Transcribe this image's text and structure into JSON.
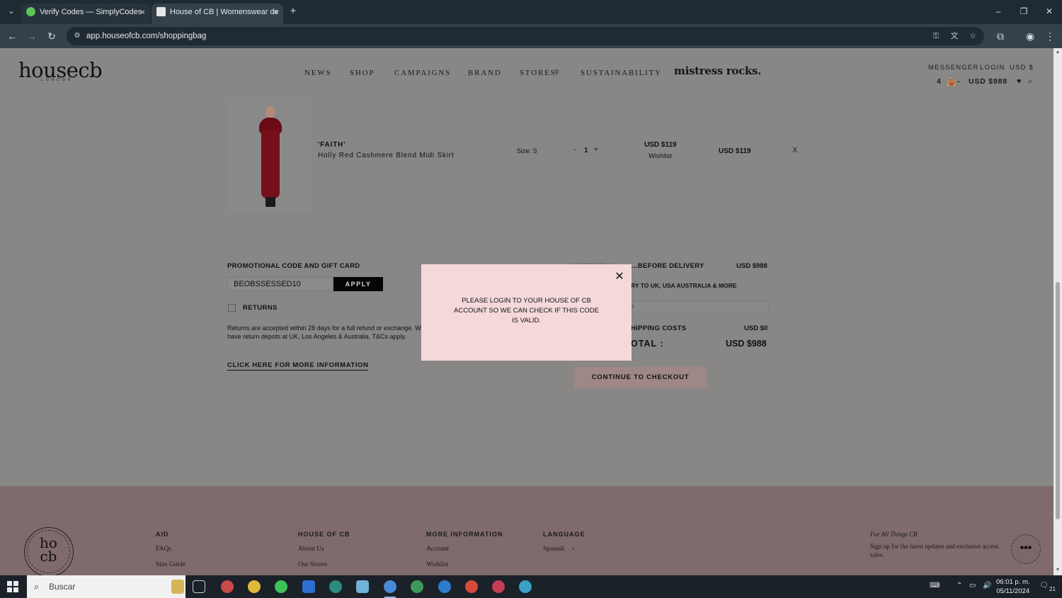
{
  "browser": {
    "tabs": [
      {
        "title": "Verify Codes — SimplyCodes",
        "close": "×"
      },
      {
        "title": "House of CB | Womenswear de",
        "close": "×"
      }
    ],
    "tab_menu_icon": "chevron-down-icon",
    "new_tab": "+",
    "window": {
      "minimize": "–",
      "restore": "❐",
      "close": "✕"
    },
    "nav": {
      "back": "←",
      "forward": "→",
      "reload": "↻"
    },
    "url": "app.houseofcb.com/shoppingbag",
    "omnibox_icons": [
      "key-icon",
      "translate-icon",
      "star-icon"
    ],
    "right_icons": [
      "extensions-icon",
      "profile-icon",
      "menu-icon"
    ]
  },
  "header": {
    "logo": "housecb",
    "logo_sub": "LONDON",
    "nav": [
      "NEWS",
      "SHOP",
      "CAMPAIGNS",
      "BRAND",
      "STORES",
      "SUSTAINABILITY"
    ],
    "stores_icon": "location-pin-icon",
    "mistress": "mistress rocks.",
    "top_links": [
      "MESSENGER",
      "LOGIN",
      "USD $"
    ],
    "bag_count": "4",
    "bag_sep": "-",
    "bag_total": "USD $988"
  },
  "cart_item": {
    "name": "'FAITH'",
    "description": "Holly Red Cashmere Blend Midi Skirt",
    "size": "Size: S",
    "qty_minus": "-",
    "qty": "1",
    "qty_plus": "+",
    "price": "USD $119",
    "wishlist": "Wishlist",
    "line_total": "USD $119",
    "remove": "X"
  },
  "promo": {
    "heading": "PROMOTIONAL CODE AND GIFT CARD",
    "code_value": "BEOBSSESSED10",
    "apply_label": "APPLY"
  },
  "returns": {
    "heading": "RETURNS",
    "text": "Returns are accepted within 28 days for a full refund or exchange. We have return depots at UK, Los Angeles & Australia. T&Cs apply.",
    "link": "CLICK HERE FOR MORE INFORMATION"
  },
  "summary": {
    "subtotal_label_visible": "…BEFORE DELIVERY",
    "subtotal_value": "USD $988",
    "delivery_note": "RY TO UK, USA AUSTRALIA & MORE",
    "country_placeholder": "n",
    "shipping_label": "HIPPING COSTS",
    "shipping_value": "USD $0",
    "total_label": "OTAL :",
    "total_value": "USD $988",
    "checkout_label": "CONTINUE TO CHECKOUT"
  },
  "modal": {
    "message": "PLEASE LOGIN TO YOUR HOUSE OF CB ACCOUNT SO WE CAN CHECK IF THIS CODE IS VALID.",
    "close": "✕"
  },
  "footer": {
    "logo_mono": "ho\ncb",
    "columns": [
      {
        "heading": "AID",
        "links": [
          "FAQs",
          "Size Guide"
        ]
      },
      {
        "heading": "HOUSE OF CB",
        "links": [
          "About Us",
          "Our Stores"
        ]
      },
      {
        "heading": "MORE INFORMATION",
        "links": [
          "Account",
          "Wishlist"
        ]
      },
      {
        "heading": "LANGUAGE",
        "links": [
          "Spanish"
        ]
      }
    ],
    "language_arrow": "›",
    "newsletter_title": "For All Things CB",
    "newsletter_text": "Sign up for the latest updates and exclusive access sales.",
    "chat_label": "•••"
  },
  "taskbar": {
    "search_placeholder": "Buscar",
    "time": "06:01 p. m.",
    "date": "05/11/2024",
    "notification_count": "21"
  },
  "colors": {
    "overlay_page": "#898686",
    "modal_bg": "#f4d8da",
    "footer_bg": "#7f6a6c",
    "checkout_bg": "#9e8786",
    "apply_bg": "#050505"
  }
}
